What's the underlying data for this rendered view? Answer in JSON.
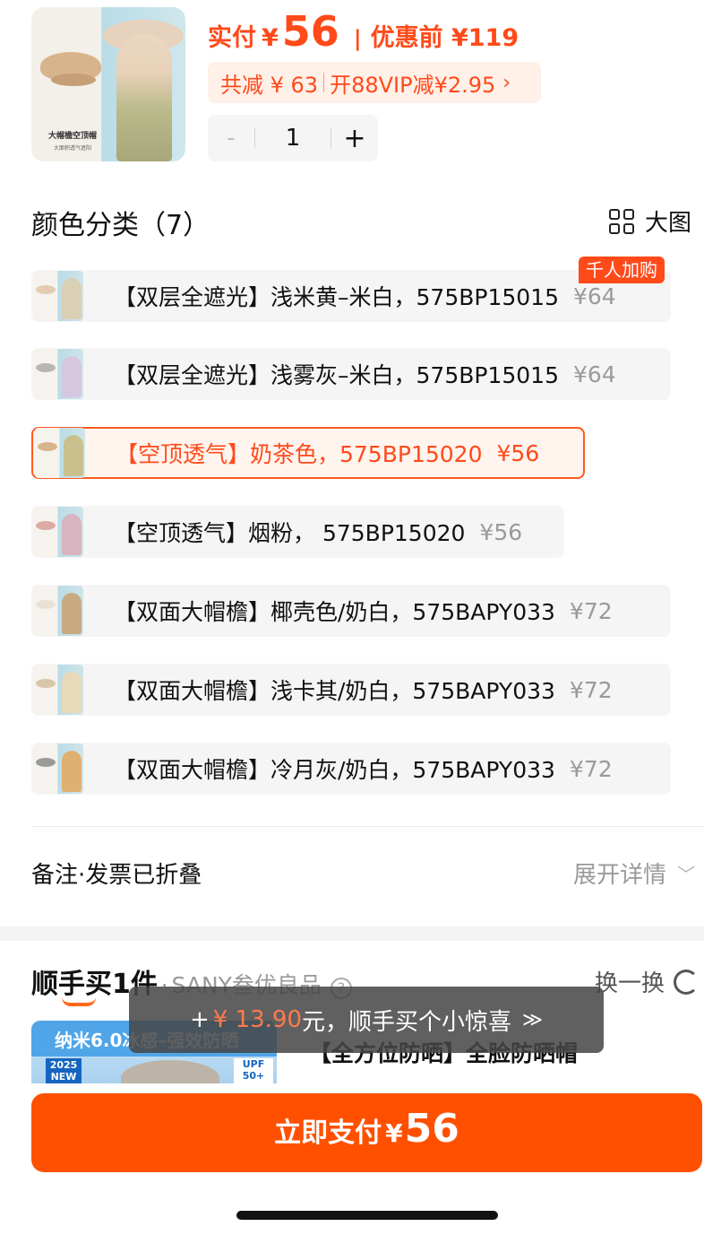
{
  "product": {
    "thumb_title": "大帽檐空顶帽",
    "thumb_sub": "大面积透气遮阳",
    "pay_label": "实付",
    "currency": "¥",
    "pay_amount": "56",
    "separator": "|",
    "before_label": "优惠前 ¥119",
    "discount_total": "共减 ¥ 63",
    "discount_vip": "开88VIP减¥2.95",
    "discount_chevron": "›",
    "quantity": "1",
    "minus": "-",
    "plus": "+"
  },
  "colors": {
    "title": "颜色分类（7）",
    "big_image_label": "大图",
    "badge": "千人加购",
    "options": [
      {
        "text": "【双层全遮光】浅米黄–米白，575BP15015",
        "price": "¥64",
        "hat": "#e2cdb3",
        "person": "#d9d0b5"
      },
      {
        "text": "【双层全遮光】浅雾灰–米白，575BP15015",
        "price": "¥64",
        "hat": "#b6b6b6",
        "person": "#d6c7e0"
      },
      {
        "text": "【空顶透气】奶茶色，575BP15020",
        "price": "¥56",
        "hat": "#d8b48c",
        "person": "#c9c08d"
      },
      {
        "text": "【空顶透气】烟粉， 575BP15020",
        "price": "¥56",
        "hat": "#dcaaa5",
        "person": "#d8b4c0"
      },
      {
        "text": "【双面大帽檐】椰壳色/奶白，575BAPY033",
        "price": "¥72",
        "hat": "#e9e2d4",
        "person": "#c8a980"
      },
      {
        "text": "【双面大帽檐】浅卡其/奶白，575BAPY033",
        "price": "¥72",
        "hat": "#d7c7a8",
        "person": "#e8d9b8"
      },
      {
        "text": "【双面大帽檐】冷月灰/奶白，575BAPY033",
        "price": "¥72",
        "hat": "#9a9a9a",
        "person": "#e0b070"
      }
    ]
  },
  "remark": {
    "label": "备注·发票已折叠",
    "expand_label": "展开详情",
    "chevron": "﹀"
  },
  "bundle": {
    "logo_text": "顺手买1件",
    "dot": "·",
    "store": "SANY叁优良品",
    "info": "?",
    "swap_label": "换一换",
    "card_band": "纳米6.0冰感–强效防晒",
    "card_year": "2025 NEW",
    "card_upf": "UPF 50+",
    "title": "【全方位防晒】全脸防晒帽"
  },
  "toast": {
    "plus": "+",
    "amount": "¥ 13.90",
    "text": "元，顺手买个小惊喜",
    "chevron": "≫"
  },
  "pay_button": {
    "label": "立即支付",
    "currency": "¥",
    "amount": "56"
  },
  "theme": {
    "accent": "#ff5000",
    "accent_text": "#ff4a1a"
  }
}
